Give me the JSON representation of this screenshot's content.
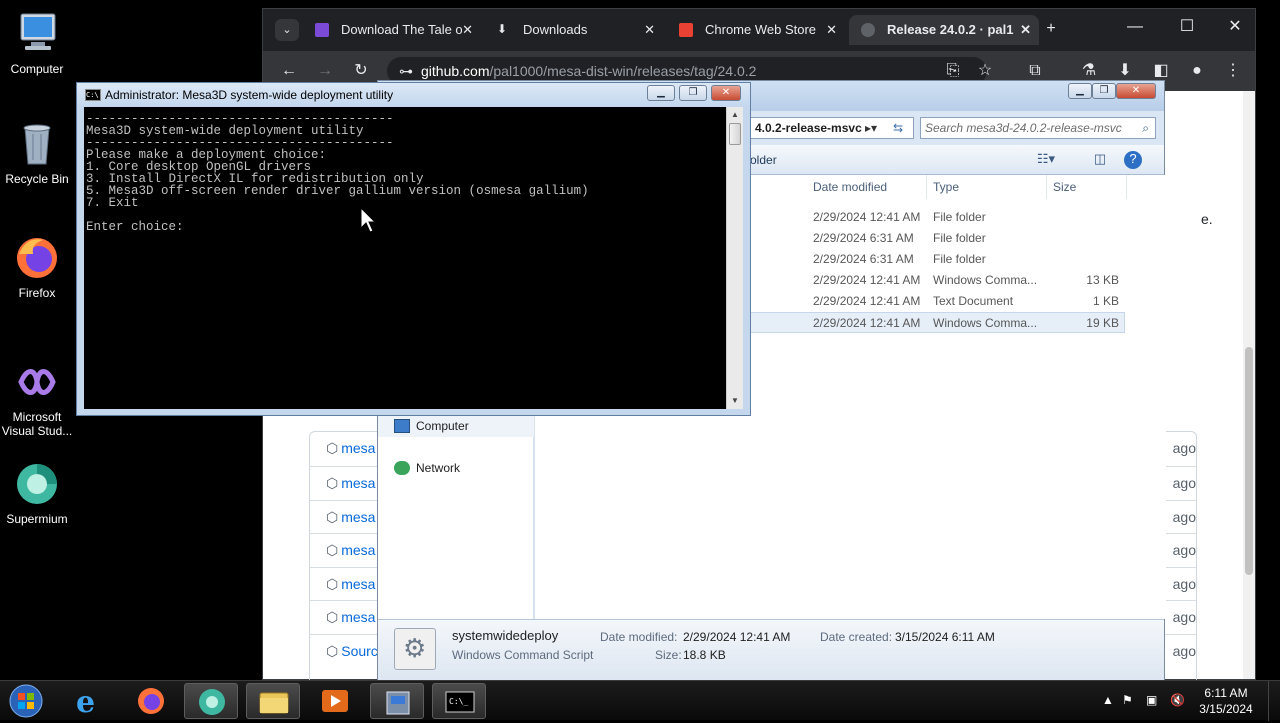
{
  "desktop": {
    "icons": [
      {
        "label": "Computer"
      },
      {
        "label": "Recycle Bin"
      },
      {
        "label": "Firefox"
      },
      {
        "label": "Microsoft Visual Stud..."
      },
      {
        "label": "Supermium"
      }
    ]
  },
  "chrome": {
    "tabs": [
      {
        "label": "Download The Tale o",
        "active": false
      },
      {
        "label": "Downloads",
        "active": false
      },
      {
        "label": "Chrome Web Store",
        "active": false
      },
      {
        "label": "Release 24.0.2 · pal1",
        "active": true
      }
    ],
    "url_host": "github.com",
    "url_path": "/pal1000/mesa-dist-win/releases/tag/24.0.2",
    "side_text": "e.",
    "assets": [
      {
        "name": "mesa",
        "ago": "ago"
      },
      {
        "name": "mesa",
        "ago": "ago"
      },
      {
        "name": "mesa",
        "ago": "ago"
      },
      {
        "name": "mesa",
        "ago": "ago"
      },
      {
        "name": "mesa",
        "ago": "ago"
      },
      {
        "name": "mesa",
        "ago": "ago"
      },
      {
        "name": "Sourc",
        "ago": "ago"
      }
    ]
  },
  "explorer": {
    "address": "4.0.2-release-msvc",
    "search_placeholder": "Search mesa3d-24.0.2-release-msvc",
    "new_folder": "older",
    "columns": {
      "date": "Date modified",
      "type": "Type",
      "size": "Size"
    },
    "rows": [
      {
        "date": "2/29/2024 12:41 AM",
        "type": "File folder",
        "size": ""
      },
      {
        "date": "2/29/2024 6:31 AM",
        "type": "File folder",
        "size": ""
      },
      {
        "date": "2/29/2024 6:31 AM",
        "type": "File folder",
        "size": ""
      },
      {
        "date": "2/29/2024 12:41 AM",
        "type": "Windows Comma...",
        "size": "13 KB"
      },
      {
        "date": "2/29/2024 12:41 AM",
        "type": "Text Document",
        "size": "1 KB"
      },
      {
        "date": "2/29/2024 12:41 AM",
        "type": "Windows Comma...",
        "size": "19 KB"
      }
    ],
    "nav": [
      {
        "label": "Computer"
      },
      {
        "label": "Network"
      }
    ],
    "details": {
      "name": "systemwidedeploy",
      "kind": "Windows Command Script",
      "date_modified_label": "Date modified:",
      "date_modified": "2/29/2024 12:41 AM",
      "date_created_label": "Date created:",
      "date_created": "3/15/2024 6:11 AM",
      "size_label": "Size:",
      "size": "18.8 KB"
    }
  },
  "console": {
    "title": "Administrator:  Mesa3D system-wide deployment utility",
    "text": "-----------------------------------------\nMesa3D system-wide deployment utility\n-----------------------------------------\nPlease make a deployment choice:\n1. Core desktop OpenGL drivers\n3. Install DirectX IL for redistribution only\n5. Mesa3D off-screen render driver gallium version (osmesa gallium)\n7. Exit\n\nEnter choice: "
  },
  "taskbar": {
    "time": "6:11 AM",
    "date": "3/15/2024"
  },
  "colors": {
    "chrome_dark": "#202124",
    "link_blue": "#0969da",
    "console_bg": "#000000",
    "console_fg": "#c0c0c0"
  }
}
